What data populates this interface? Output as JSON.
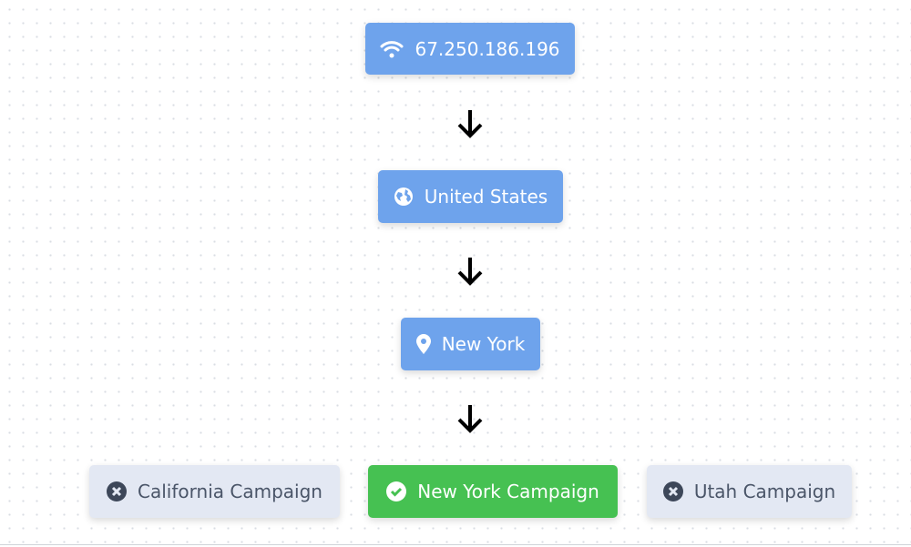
{
  "flow": {
    "ip": {
      "label": "67.250.186.196",
      "icon": "wifi-icon"
    },
    "country": {
      "label": "United States",
      "icon": "globe-icon"
    },
    "region": {
      "label": "New York",
      "icon": "map-pin-icon"
    },
    "campaigns": [
      {
        "label": "California Campaign",
        "status": "rejected",
        "icon": "x-circle-icon"
      },
      {
        "label": "New York Campaign",
        "status": "matched",
        "icon": "check-circle-icon"
      },
      {
        "label": "Utah Campaign",
        "status": "rejected",
        "icon": "x-circle-icon"
      }
    ]
  },
  "colors": {
    "node": "#6ea3ec",
    "matched": "#46c152",
    "rejected": "#e3e8f3",
    "rejected_text": "#4a5568"
  }
}
